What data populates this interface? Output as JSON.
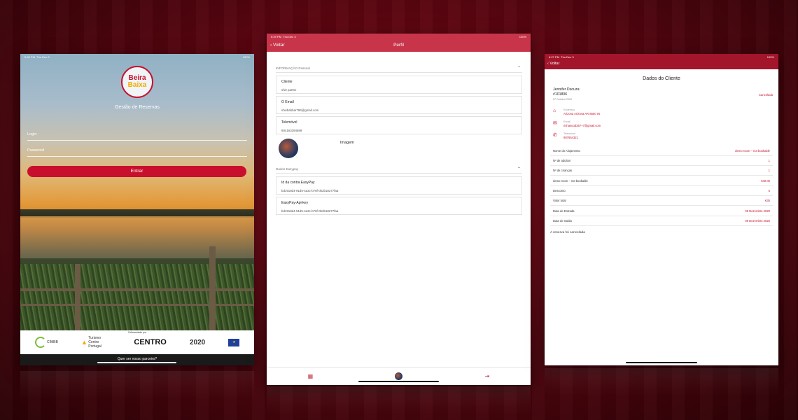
{
  "colors": {
    "brand_red": "#c8102e",
    "nav_red": "#c8354a",
    "nav_dark_red": "#a3152b"
  },
  "login": {
    "status_time": "5:26 PM",
    "status_date": "Thu Dec 3",
    "battery": "100%",
    "logo_line1": "Beira",
    "logo_line2": "Baixa",
    "subtitle": "Gestão de Reservas",
    "login_placeholder": "Login",
    "password_placeholder": "Password",
    "enter_label": "Entrar",
    "cofinanced_label": "Cofinanciado por",
    "sponsors": [
      "CIMBB",
      "Turismo Centro Portugal",
      "CENTRO",
      "2020"
    ],
    "partner_link": "Quer ser nosso parceiro?"
  },
  "perfil": {
    "status_time": "5:29 PM",
    "status_date": "Thu Dec 3",
    "battery": "100%",
    "back_label": "Voltar",
    "title": "Perfil",
    "section_personal": "INFORMAÇÃO Pessoal",
    "fields": [
      {
        "label": "Cliente",
        "value": "shiv partne"
      },
      {
        "label": "O Email",
        "value": "shivbabbar786@gmail.com"
      },
      {
        "label": "Telemóvel",
        "value": "904163394699"
      }
    ],
    "image_label": "Imagem",
    "section_easypay": "Dados Easypay",
    "easypay_fields": [
      {
        "label": "Id da contra EasyPay",
        "value": "bd1918d4-91d5-4a3c-b76f-0b2b18277faa"
      },
      {
        "label": "EasyPay-Api-key",
        "value": "bd1918d4-91d5-4a3c-b76f-0b2b18277faa"
      }
    ]
  },
  "cliente": {
    "status_time": "6:27 PM",
    "status_date": "Thu Dec 3",
    "battery": "100%",
    "back_label": "Voltar",
    "title": "Dados do Cliente",
    "name": "Jennifer Dsouza:",
    "booking_id": "#101806",
    "date": "27 Outubro 2020",
    "status": "Cancelada",
    "contacts": [
      {
        "icon": "home-icon",
        "label": "Endereço",
        "value": "Arizona Arizona AR 8500 IN"
      },
      {
        "icon": "mail-icon",
        "label": "Email",
        "value": "richasood367+7@gmail.com"
      },
      {
        "icon": "phone-icon",
        "label": "Telemóvel",
        "value": "987654321"
      }
    ],
    "details": [
      {
        "key": "Nome do Alojamento",
        "value": "demo room – not bookable"
      },
      {
        "key": "Nº de adultos",
        "value": "1"
      },
      {
        "key": "Nº de crianças",
        "value": "1"
      },
      {
        "key": "demo room – not bookable",
        "value": "€40.00"
      },
      {
        "key": "Desconto",
        "value": "5"
      },
      {
        "key": "Valor total",
        "value": "€35"
      },
      {
        "key": "Data de Entrada",
        "value": "05 Dezembro 2020"
      },
      {
        "key": "Data de Saída",
        "value": "09 Dezembro 2020"
      }
    ],
    "cancel_note": "A reserva foi cancelada"
  }
}
